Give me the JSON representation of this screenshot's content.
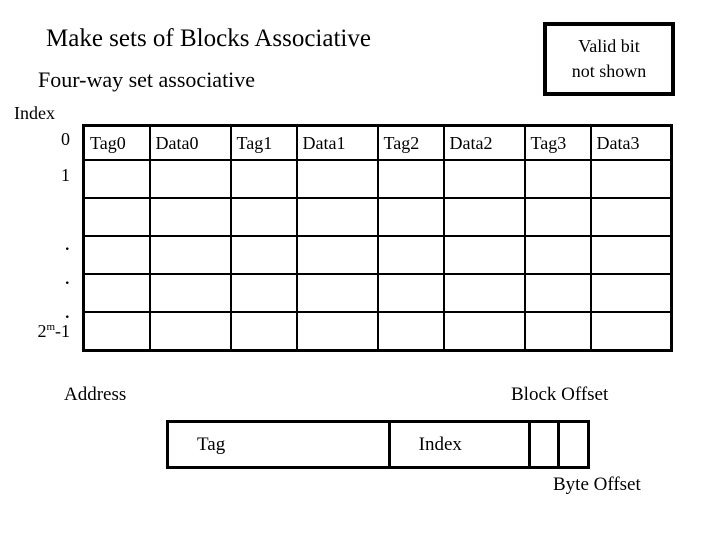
{
  "slide": {
    "title": "Make sets of Blocks Associative",
    "subtitle": "Four-way set associative"
  },
  "valid_bit_note": {
    "line1": "Valid bit",
    "line2": "not shown"
  },
  "cache_table": {
    "index_label": "Index",
    "columns": [
      "Tag0",
      "Data0",
      "Tag1",
      "Data1",
      "Tag2",
      "Data2",
      "Tag3",
      "Data3"
    ],
    "row_labels": [
      "0",
      "1",
      "",
      ".",
      ".",
      ".",
      "2m-1"
    ],
    "last_row_label": {
      "base": "2",
      "exponent": "m",
      "suffix": "-1"
    },
    "row_count": 6,
    "column_count": 8
  },
  "address_diagram": {
    "address_label": "Address",
    "block_offset_label": "Block Offset",
    "byte_offset_label": "Byte Offset",
    "fields": [
      "Tag",
      "Index",
      "",
      ""
    ]
  },
  "colors": {
    "background": "#ffffff",
    "ink": "#000000"
  }
}
